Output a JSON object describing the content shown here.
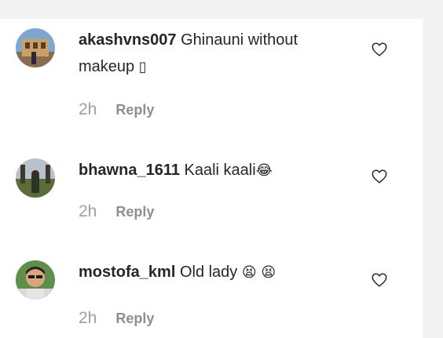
{
  "comments": [
    {
      "username": "akashvns007",
      "text": "Ghinauni without makeup",
      "emoji": "▯",
      "time": "2h",
      "reply_label": "Reply",
      "avatar_icon": "avatar-photo-icon",
      "like_icon": "heart-outline-icon"
    },
    {
      "username": "bhawna_1611",
      "text": "Kaali kaali",
      "emoji": "😂",
      "time": "2h",
      "reply_label": "Reply",
      "avatar_icon": "avatar-photo-icon",
      "like_icon": "heart-outline-icon"
    },
    {
      "username": "mostofa_kml",
      "text": "Old lady",
      "emoji": "😫 😫",
      "time": "2h",
      "reply_label": "Reply",
      "avatar_icon": "avatar-photo-icon",
      "like_icon": "heart-outline-icon"
    }
  ],
  "colors": {
    "text_primary": "#262626",
    "text_secondary": "#8e8e8e",
    "background": "#ffffff",
    "border_strip": "#f3f3f3"
  }
}
